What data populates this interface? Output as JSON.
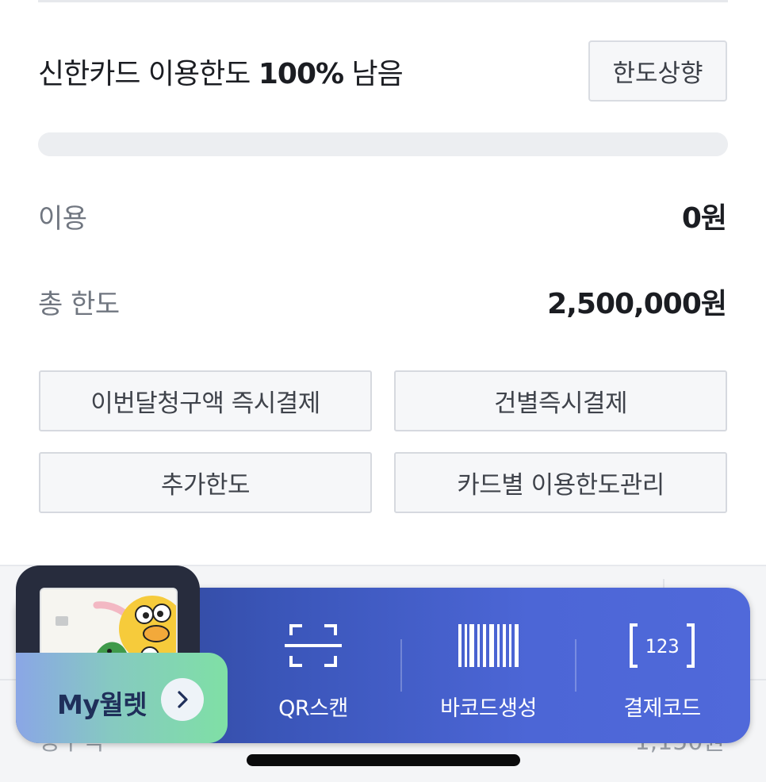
{
  "limit": {
    "title_prefix": "신한카드 이용한도 ",
    "title_percent": "100%",
    "title_suffix": " 남음",
    "raise_button": "한도상향",
    "remaining_fraction": 1.0
  },
  "summary": {
    "used_label": "이용",
    "used_value": "0원",
    "total_label": "총 한도",
    "total_value": "2,500,000원"
  },
  "actions": {
    "pay_bill_now": "이번달청구액 즉시결제",
    "pay_per_item": "건별즉시결제",
    "extra_limit": "추가한도",
    "card_limit_manage": "카드별 이용한도관리"
  },
  "bottom_bar": {
    "wallet_label": "My월렛",
    "qr_label": "QR스캔",
    "barcode_label": "바코드생성",
    "paycode_label": "결제코드",
    "paycode_icon_text": "123"
  },
  "background": {
    "left_text": "청구액",
    "right_text": "1,150원"
  },
  "colors": {
    "bar_start": "#2a3e84",
    "bar_end": "#5069da",
    "wallet_green": "#7fe0a5",
    "wallet_dark": "#272c3d"
  }
}
